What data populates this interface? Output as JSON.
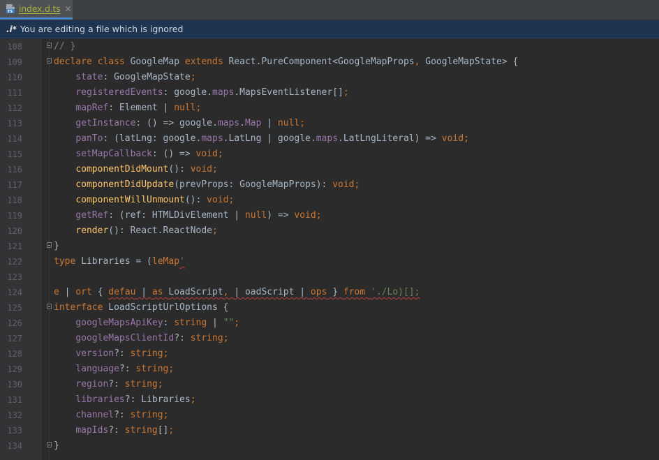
{
  "tab": {
    "label": "index.d.ts",
    "close_glyph": "✕",
    "icon": "typescript-file-icon",
    "icon_text": "TS"
  },
  "banner": {
    "icon_label": ".i*",
    "message": "You are editing a file which is ignored"
  },
  "colors": {
    "keyword": "#cc7832",
    "function": "#ffc66d",
    "property": "#9876aa",
    "string": "#6a8759",
    "comment": "#808080",
    "text": "#a9b7c6",
    "line_number": "#606366",
    "banner_bg": "#1e3450",
    "tab_label": "#a9b23f"
  },
  "lines": [
    {
      "n": "108",
      "fold": true,
      "tokens": [
        [
          "c",
          "// }"
        ]
      ]
    },
    {
      "n": "109",
      "fold": true,
      "tokens": [
        [
          "k",
          "declare "
        ],
        [
          "k",
          "class "
        ],
        [
          "t",
          "GoogleMap "
        ],
        [
          "k",
          "extends "
        ],
        [
          "t",
          "React.PureComponent<GoogleMapProps"
        ],
        [
          "k",
          ", "
        ],
        [
          "t",
          "GoogleMapState> {"
        ]
      ]
    },
    {
      "n": "110",
      "tokens": [
        [
          "t",
          "    "
        ],
        [
          "p",
          "state"
        ],
        [
          "t",
          ": GoogleMapState"
        ],
        [
          "k",
          ";"
        ]
      ]
    },
    {
      "n": "111",
      "tokens": [
        [
          "t",
          "    "
        ],
        [
          "p",
          "registeredEvents"
        ],
        [
          "t",
          ": google."
        ],
        [
          "p",
          "maps"
        ],
        [
          "t",
          ".MapsEventListener[]"
        ],
        [
          "k",
          ";"
        ]
      ]
    },
    {
      "n": "112",
      "tokens": [
        [
          "t",
          "    "
        ],
        [
          "p",
          "mapRef"
        ],
        [
          "t",
          ": Element | "
        ],
        [
          "k",
          "null"
        ],
        [
          "k",
          ";"
        ]
      ]
    },
    {
      "n": "113",
      "tokens": [
        [
          "t",
          "    "
        ],
        [
          "p",
          "getInstance"
        ],
        [
          "t",
          ": () => google."
        ],
        [
          "p",
          "maps"
        ],
        [
          "t",
          "."
        ],
        [
          "p",
          "Map"
        ],
        [
          "t",
          " | "
        ],
        [
          "k",
          "null"
        ],
        [
          "k",
          ";"
        ]
      ]
    },
    {
      "n": "114",
      "tokens": [
        [
          "t",
          "    "
        ],
        [
          "p",
          "panTo"
        ],
        [
          "t",
          ": (latLng: google."
        ],
        [
          "p",
          "maps"
        ],
        [
          "t",
          ".LatLng | google."
        ],
        [
          "p",
          "maps"
        ],
        [
          "t",
          ".LatLngLiteral) => "
        ],
        [
          "k",
          "void"
        ],
        [
          "k",
          ";"
        ]
      ]
    },
    {
      "n": "115",
      "tokens": [
        [
          "t",
          "    "
        ],
        [
          "p",
          "setMapCallback"
        ],
        [
          "t",
          ": () => "
        ],
        [
          "k",
          "void"
        ],
        [
          "k",
          ";"
        ]
      ]
    },
    {
      "n": "116",
      "tokens": [
        [
          "t",
          "    "
        ],
        [
          "f",
          "componentDidMount"
        ],
        [
          "t",
          "(): "
        ],
        [
          "k",
          "void"
        ],
        [
          "k",
          ";"
        ]
      ]
    },
    {
      "n": "117",
      "tokens": [
        [
          "t",
          "    "
        ],
        [
          "f",
          "componentDidUpdate"
        ],
        [
          "t",
          "(prevProps: GoogleMapProps): "
        ],
        [
          "k",
          "void"
        ],
        [
          "k",
          ";"
        ]
      ]
    },
    {
      "n": "118",
      "tokens": [
        [
          "t",
          "    "
        ],
        [
          "f",
          "componentWillUnmount"
        ],
        [
          "t",
          "(): "
        ],
        [
          "k",
          "void"
        ],
        [
          "k",
          ";"
        ]
      ]
    },
    {
      "n": "119",
      "tokens": [
        [
          "t",
          "    "
        ],
        [
          "p",
          "getRef"
        ],
        [
          "t",
          ": (ref: HTMLDivElement | "
        ],
        [
          "k",
          "null"
        ],
        [
          "t",
          ") => "
        ],
        [
          "k",
          "void"
        ],
        [
          "k",
          ";"
        ]
      ]
    },
    {
      "n": "120",
      "tokens": [
        [
          "t",
          "    "
        ],
        [
          "f",
          "render"
        ],
        [
          "t",
          "(): React.ReactNode"
        ],
        [
          "k",
          ";"
        ]
      ]
    },
    {
      "n": "121",
      "fold": true,
      "tokens": [
        [
          "t",
          "}"
        ]
      ]
    },
    {
      "n": "122",
      "tokens": [
        [
          "k",
          "type "
        ],
        [
          "t",
          "Libraries = ("
        ],
        [
          "k",
          "leMap"
        ],
        [
          "s",
          "'"
        ]
      ],
      "error_from": 3
    },
    {
      "n": "123",
      "tokens": []
    },
    {
      "n": "124",
      "tokens": [
        [
          "k",
          "e"
        ],
        [
          "t",
          " | "
        ],
        [
          "k",
          "ort "
        ],
        [
          "t",
          "{ "
        ],
        [
          "k",
          "defau"
        ],
        [
          "t",
          " | "
        ],
        [
          "k",
          "as "
        ],
        [
          "t",
          "LoadScript"
        ],
        [
          "k",
          ", "
        ],
        [
          "t",
          "| oadScript | "
        ],
        [
          "k",
          "ops"
        ],
        [
          "t",
          " } "
        ],
        [
          "k",
          "from "
        ],
        [
          "s",
          "'./Lo)[];"
        ]
      ],
      "error_from": 4
    },
    {
      "n": "125",
      "fold": true,
      "tokens": [
        [
          "k",
          "interface "
        ],
        [
          "t",
          "LoadScriptUrlOptions {"
        ]
      ]
    },
    {
      "n": "126",
      "tokens": [
        [
          "t",
          "    "
        ],
        [
          "p",
          "googleMapsApiKey"
        ],
        [
          "t",
          ": "
        ],
        [
          "k",
          "string"
        ],
        [
          "t",
          " | "
        ],
        [
          "s",
          "\"\""
        ],
        [
          "k",
          ";"
        ]
      ]
    },
    {
      "n": "127",
      "tokens": [
        [
          "t",
          "    "
        ],
        [
          "p",
          "googleMapsClientId"
        ],
        [
          "t",
          "?: "
        ],
        [
          "k",
          "string"
        ],
        [
          "k",
          ";"
        ]
      ]
    },
    {
      "n": "128",
      "tokens": [
        [
          "t",
          "    "
        ],
        [
          "p",
          "version"
        ],
        [
          "t",
          "?: "
        ],
        [
          "k",
          "string"
        ],
        [
          "k",
          ";"
        ]
      ]
    },
    {
      "n": "129",
      "tokens": [
        [
          "t",
          "    "
        ],
        [
          "p",
          "language"
        ],
        [
          "t",
          "?: "
        ],
        [
          "k",
          "string"
        ],
        [
          "k",
          ";"
        ]
      ]
    },
    {
      "n": "130",
      "tokens": [
        [
          "t",
          "    "
        ],
        [
          "p",
          "region"
        ],
        [
          "t",
          "?: "
        ],
        [
          "k",
          "string"
        ],
        [
          "k",
          ";"
        ]
      ]
    },
    {
      "n": "131",
      "tokens": [
        [
          "t",
          "    "
        ],
        [
          "p",
          "libraries"
        ],
        [
          "t",
          "?: Libraries"
        ],
        [
          "k",
          ";"
        ]
      ]
    },
    {
      "n": "132",
      "tokens": [
        [
          "t",
          "    "
        ],
        [
          "p",
          "channel"
        ],
        [
          "t",
          "?: "
        ],
        [
          "k",
          "string"
        ],
        [
          "k",
          ";"
        ]
      ]
    },
    {
      "n": "133",
      "tokens": [
        [
          "t",
          "    "
        ],
        [
          "p",
          "mapIds"
        ],
        [
          "t",
          "?: "
        ],
        [
          "k",
          "string"
        ],
        [
          "t",
          "[]"
        ],
        [
          "k",
          ";"
        ]
      ]
    },
    {
      "n": "134",
      "fold": true,
      "tokens": [
        [
          "t",
          "}"
        ]
      ]
    }
  ]
}
